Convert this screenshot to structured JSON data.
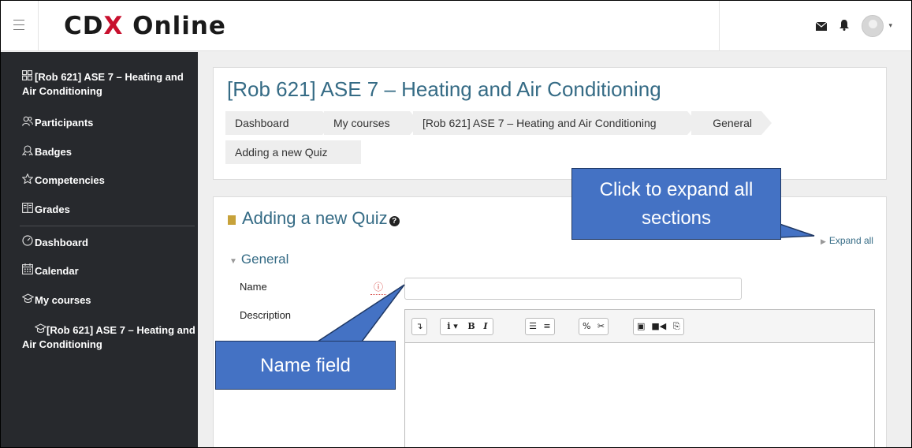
{
  "header": {
    "logo_main": "CD",
    "logo_x": "X",
    "logo_rest": " Online",
    "user_menu_caret": "▾"
  },
  "sidebar": {
    "items": [
      {
        "label": "[Rob 621] ASE 7 – Heating and Air Conditioning",
        "icon": "course-grid-icon"
      },
      {
        "label": "Participants",
        "icon": "participants-icon"
      },
      {
        "label": "Badges",
        "icon": "badge-icon"
      },
      {
        "label": "Competencies",
        "icon": "star-icon"
      },
      {
        "label": "Grades",
        "icon": "grades-icon"
      },
      {
        "label": "Dashboard",
        "icon": "dashboard-icon"
      },
      {
        "label": "Calendar",
        "icon": "calendar-icon"
      },
      {
        "label": "My courses",
        "icon": "graduation-cap-icon"
      },
      {
        "label": "[Rob 621] ASE 7 – Heating and Air Conditioning",
        "icon": "graduation-cap-icon"
      }
    ]
  },
  "page": {
    "course_title": "[Rob 621] ASE 7 – Heating and Air Conditioning",
    "breadcrumb": [
      "Dashboard",
      "My courses",
      "[Rob 621] ASE 7 – Heating and Air Conditioning",
      "General",
      "Adding a new Quiz"
    ]
  },
  "form": {
    "heading": "Adding a new Quiz",
    "help_glyph": "?",
    "expand_all": "Expand all",
    "section_general": "General",
    "name_label": "Name",
    "required_glyph": "ⓘ",
    "name_value": "",
    "description_label": "Description",
    "toolbar": {
      "toggle": "↴",
      "style": "i ▾",
      "bold": "B",
      "italic": "I",
      "ul": "☰",
      "ol": "≡",
      "link": "%",
      "unlink": "✂",
      "image": "▣",
      "media": "■◀",
      "manage": "⎘"
    }
  },
  "callouts": {
    "expand": "Click to expand all sections",
    "name_field": "Name field"
  },
  "colors": {
    "sidebar_bg": "#27292d",
    "link_blue": "#356b85",
    "callout_fill": "#4472c4",
    "callout_border": "#1f3864",
    "logo_red": "#c8102e"
  }
}
